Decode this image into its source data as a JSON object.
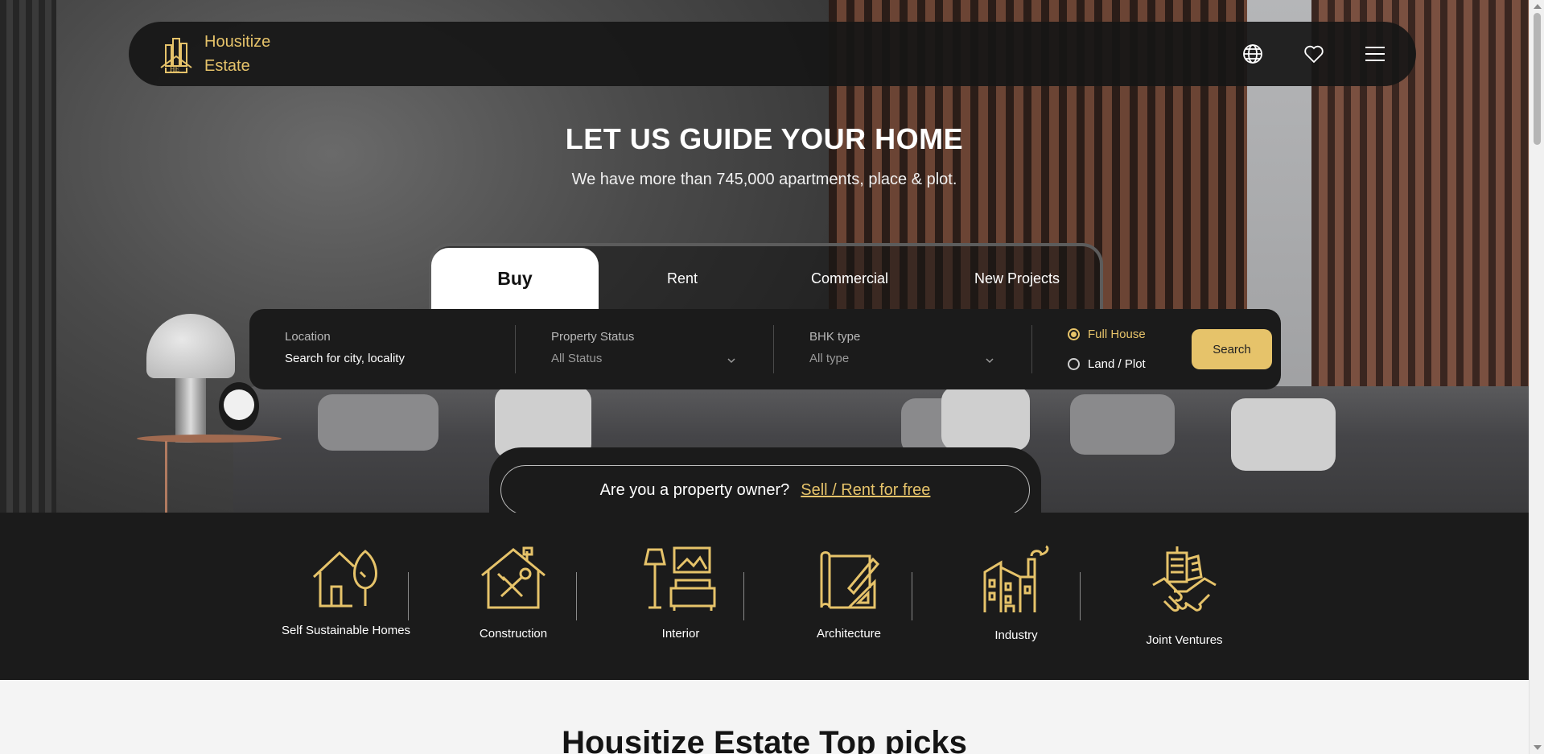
{
  "brand": {
    "line1": "Housitize",
    "line2": "Estate",
    "accent": "#e6c36a"
  },
  "nav": {
    "icons": [
      "globe-icon",
      "heart-icon",
      "menu-icon"
    ]
  },
  "hero": {
    "title": "LET US GUIDE YOUR HOME",
    "subtitle": "We have more than 745,000 apartments, place & plot."
  },
  "tabs": [
    {
      "label": "Buy",
      "active": true
    },
    {
      "label": "Rent",
      "active": false
    },
    {
      "label": "Commercial",
      "active": false
    },
    {
      "label": "New Projects",
      "active": false
    }
  ],
  "search": {
    "location": {
      "label": "Location",
      "value": "Search for city, locality"
    },
    "status": {
      "label": "Property Status",
      "value": "All Status"
    },
    "bhk": {
      "label": "BHK type",
      "value": "All type"
    },
    "options": [
      {
        "label": "Full House",
        "selected": true
      },
      {
        "label": "Land / Plot",
        "selected": false
      }
    ],
    "button": "Search"
  },
  "owner": {
    "question": "Are you a property owner?",
    "link": "Sell / Rent for free"
  },
  "services": [
    {
      "label": "Self Sustainable Homes",
      "icon": "eco-home-icon"
    },
    {
      "label": "Construction",
      "icon": "construction-icon"
    },
    {
      "label": "Interior",
      "icon": "interior-icon"
    },
    {
      "label": "Architecture",
      "icon": "architecture-icon"
    },
    {
      "label": "Industry",
      "icon": "industry-icon"
    },
    {
      "label": "Joint Ventures",
      "icon": "handshake-icon"
    }
  ],
  "picks": {
    "title": "Housitize Estate Top picks"
  }
}
